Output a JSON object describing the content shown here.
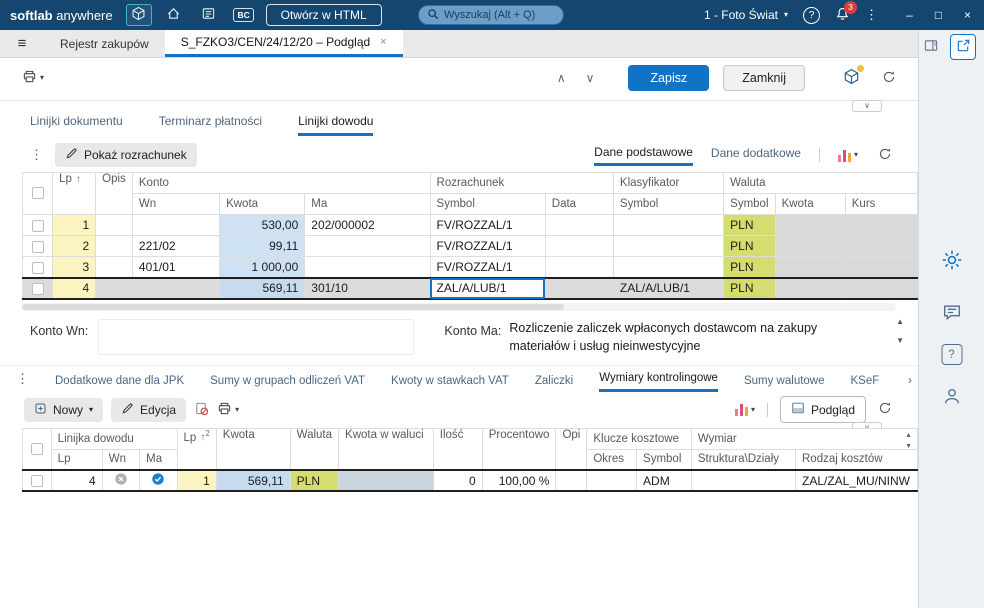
{
  "colors": {
    "topbar": "#14466f",
    "accent": "#1273c4",
    "badge_red": "#dd3b3b",
    "cell_yellow": "#fbf4c0",
    "cell_blue": "#cfe2f3",
    "cell_green": "#d6dd70",
    "cell_gray": "#d9d9d9",
    "selected_row": "#dcdcdc"
  },
  "icons": {
    "menu": "≡",
    "dots": "⋮",
    "caret": "▾",
    "chevron_up": "∧",
    "chevron_down": "∨",
    "question": "?",
    "minimize": "–",
    "maximize": "□",
    "close": "×",
    "tab_close": "×",
    "sort_asc": "↑",
    "sort_order": "2",
    "scroll_up": "▲",
    "scroll_down": "▼",
    "overflow": "›"
  },
  "titlebar": {
    "brand_bold": "softlab",
    "brand_light": " anywhere",
    "bc_label": "BC",
    "open_html": "Otwórz w HTML",
    "search_placeholder": "Wyszukaj (Alt + Q)",
    "company": "1 - Foto Świat",
    "notifications": "3"
  },
  "tabstrip": {
    "menu_tab": "Rejestr zakupów",
    "active_tab": "S_FZKO3/CEN/24/12/20 – Podgląd"
  },
  "doc_toolbar": {
    "save": "Zapisz",
    "close": "Zamknij"
  },
  "section_tabs": {
    "tab1": "Linijki dokumentu",
    "tab2": "Terminarz płatności",
    "tab3": "Linijki dowodu"
  },
  "lines_toolbar": {
    "show_settlement": "Pokaż rozrachunek",
    "basic_data": "Dane podstawowe",
    "additional_data": "Dane dodatkowe"
  },
  "lines_grid": {
    "headers": {
      "lp": "Lp",
      "opis": "Opis",
      "konto": "Konto",
      "wn": "Wn",
      "kwota": "Kwota",
      "ma": "Ma",
      "rozrachunek": "Rozrachunek",
      "symbol": "Symbol",
      "data": "Data",
      "klasyfikator": "Klasyfikator",
      "waluta": "Waluta",
      "kurs": "Kurs"
    },
    "rows": [
      {
        "lp": "1",
        "opis": "",
        "wn": "",
        "kwota": "530,00",
        "ma": "202/000002",
        "roz_symbol": "FV/ROZZAL/1",
        "data": "",
        "klas_symbol": "",
        "wal_symbol": "PLN",
        "wal_kwota": "",
        "kurs": ""
      },
      {
        "lp": "2",
        "opis": "",
        "wn": "221/02",
        "kwota": "99,11",
        "ma": "",
        "roz_symbol": "FV/ROZZAL/1",
        "data": "",
        "klas_symbol": "",
        "wal_symbol": "PLN",
        "wal_kwota": "",
        "kurs": ""
      },
      {
        "lp": "3",
        "opis": "",
        "wn": "401/01",
        "kwota": "1 000,00",
        "ma": "",
        "roz_symbol": "FV/ROZZAL/1",
        "data": "",
        "klas_symbol": "",
        "wal_symbol": "PLN",
        "wal_kwota": "",
        "kurs": ""
      },
      {
        "lp": "4",
        "opis": "",
        "wn": "",
        "kwota": "569,11",
        "ma": "301/10",
        "roz_symbol": "ZAL/A/LUB/1",
        "data": "",
        "klas_symbol": "ZAL/A/LUB/1",
        "wal_symbol": "PLN",
        "wal_kwota": "",
        "kurs": ""
      }
    ]
  },
  "konto_panel": {
    "wn_label": "Konto Wn:",
    "wn_value": "",
    "ma_label": "Konto Ma:",
    "ma_value": "Rozliczenie zaliczek wpłaconych dostawcom na zakupy materiałów i usług nieinwestycyjne"
  },
  "detail_tabs": {
    "tab1": "Dodatkowe dane dla JPK",
    "tab2": "Sumy w grupach odliczeń VAT",
    "tab3": "Kwoty w stawkach VAT",
    "tab4": "Zaliczki",
    "tab5": "Wymiary kontrolingowe",
    "tab6": "Sumy walutowe",
    "tab7": "KSeF"
  },
  "detail_toolbar": {
    "new": "Nowy",
    "edit": "Edycja",
    "preview": "Podgląd"
  },
  "dims_grid": {
    "headers": {
      "linijka": "Linijka dowodu",
      "lp": "Lp",
      "wn": "Wn",
      "ma": "Ma",
      "kwota": "Kwota",
      "waluta": "Waluta",
      "kwota_w_walucie": "Kwota w waluci",
      "ilosc": "Ilość",
      "procentowo": "Procentowo",
      "opis": "Opi",
      "klucze": "Klucze kosztowe",
      "okres": "Okres",
      "symbol": "Symbol",
      "wymiar": "Wymiar",
      "struktura": "Struktura\\Działy",
      "rodzaj": "Rodzaj kosztów"
    },
    "rows": [
      {
        "linijka_lp": "4",
        "lp": "1",
        "kwota": "569,11",
        "waluta": "PLN",
        "kwota_w_walucie": "",
        "ilosc": "0",
        "procentowo": "100,00 %",
        "opis": "",
        "okres": "",
        "symbol": "ADM",
        "struktura": "",
        "rodzaj": "ZAL/ZAL_MU/NINW"
      }
    ]
  }
}
